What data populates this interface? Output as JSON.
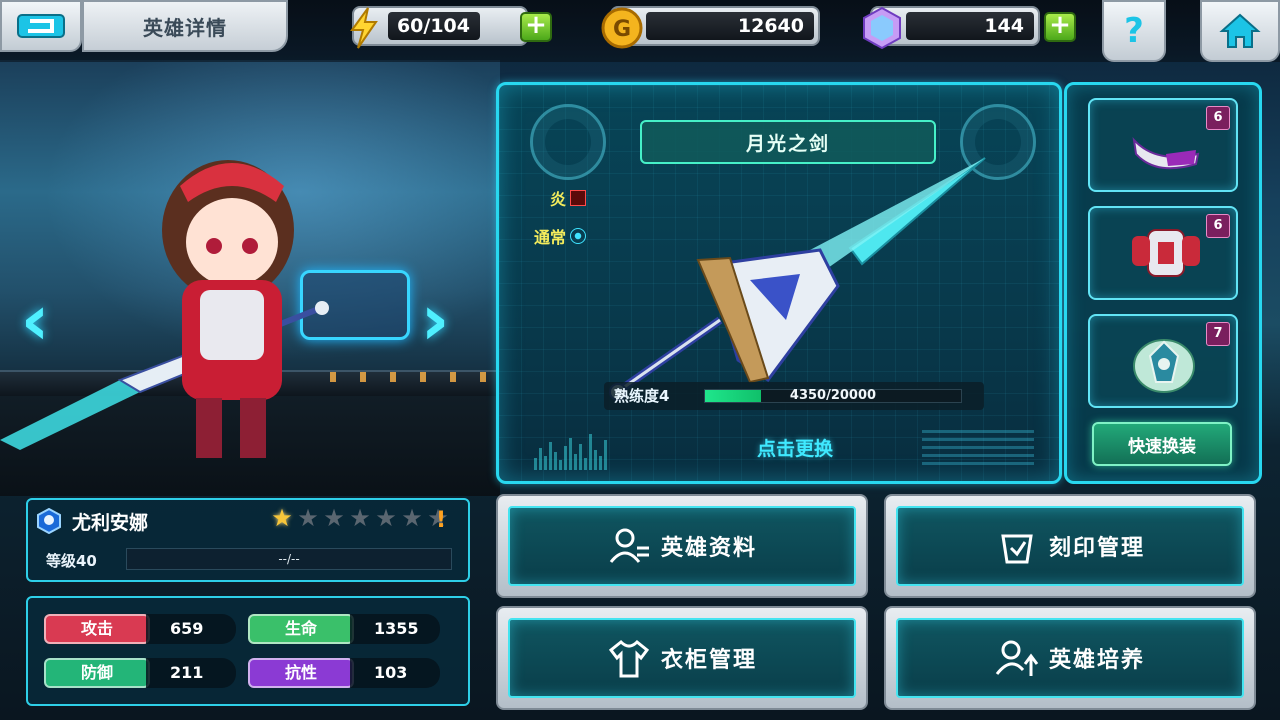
{
  "header": {
    "title": "英雄详情",
    "energy": "60/104",
    "gold": "12640",
    "gems": "144",
    "help_label": "?"
  },
  "weapon": {
    "name": "月光之剑",
    "element": "炎",
    "attack_type": "通常",
    "proficiency_label": "熟练度4",
    "proficiency_value": "4350/20000",
    "proficiency_fraction": 0.2175,
    "tap_change_label": "点击更换"
  },
  "equipment": {
    "slots": [
      {
        "name": "helmet",
        "level": "6"
      },
      {
        "name": "armor",
        "level": "6"
      },
      {
        "name": "emblem",
        "level": "7"
      }
    ],
    "quick_equip_label": "快速换装"
  },
  "hero": {
    "name": "尤利安娜",
    "stars_total": 7,
    "stars_filled": 1,
    "warning": "!",
    "level_label": "等级40",
    "exp_text": "--/--"
  },
  "stats": [
    {
      "label": "攻击",
      "value": "659",
      "color": "#d93a52"
    },
    {
      "label": "生命",
      "value": "1355",
      "color": "#3ac06a"
    },
    {
      "label": "防御",
      "value": "211",
      "color": "#23b578"
    },
    {
      "label": "抗性",
      "value": "103",
      "color": "#8b3ad4"
    }
  ],
  "menu": {
    "hero_info": "英雄资料",
    "imprint": "刻印管理",
    "wardrobe": "衣柜管理",
    "train": "英雄培养"
  },
  "colors": {
    "accent": "#28d8f0",
    "gold": "#f7c63a",
    "green": "#1fe68c"
  }
}
